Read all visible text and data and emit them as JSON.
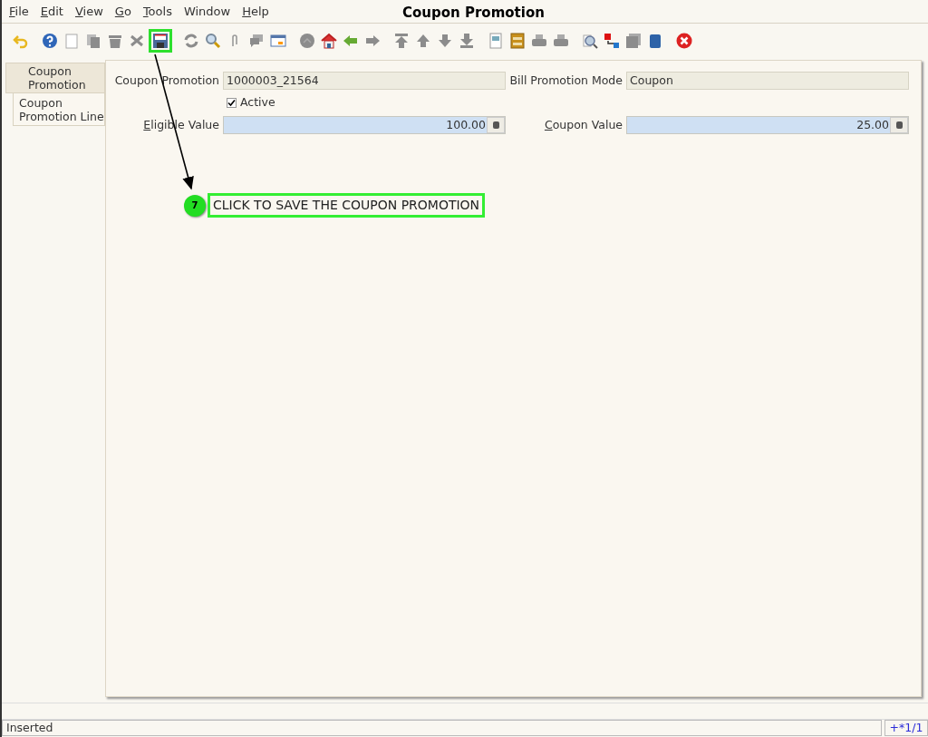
{
  "window": {
    "title": "Coupon Promotion"
  },
  "menu": [
    {
      "label": "File",
      "underlined": true
    },
    {
      "label": "Edit",
      "underlined": true
    },
    {
      "label": "View",
      "underlined": true
    },
    {
      "label": "Go",
      "underlined": true
    },
    {
      "label": "Tools",
      "underlined": true
    },
    {
      "label": "Window",
      "underlined": false
    },
    {
      "label": "Help",
      "underlined": true
    }
  ],
  "toolbar": [
    {
      "kind": "undo",
      "highlighted": false
    },
    {
      "kind": "help",
      "highlighted": false
    },
    {
      "kind": "new",
      "highlighted": false
    },
    {
      "kind": "copy",
      "highlighted": false
    },
    {
      "kind": "delete",
      "highlighted": false
    },
    {
      "kind": "delete-selection",
      "highlighted": false
    },
    {
      "kind": "save",
      "highlighted": true
    },
    {
      "kind": "refresh",
      "highlighted": false
    },
    {
      "kind": "find",
      "highlighted": false
    },
    {
      "kind": "attachment",
      "highlighted": false
    },
    {
      "kind": "chat",
      "highlighted": false
    },
    {
      "kind": "grid",
      "highlighted": false
    },
    {
      "kind": "history",
      "highlighted": false
    },
    {
      "kind": "home",
      "highlighted": false
    },
    {
      "kind": "back",
      "highlighted": false
    },
    {
      "kind": "forward",
      "highlighted": false
    },
    {
      "kind": "first",
      "highlighted": false
    },
    {
      "kind": "previous",
      "highlighted": false
    },
    {
      "kind": "next",
      "highlighted": false
    },
    {
      "kind": "last",
      "highlighted": false
    },
    {
      "kind": "report",
      "highlighted": false
    },
    {
      "kind": "archive",
      "highlighted": false
    },
    {
      "kind": "print-preview",
      "highlighted": false
    },
    {
      "kind": "print",
      "highlighted": false
    },
    {
      "kind": "zoom-across",
      "highlighted": false
    },
    {
      "kind": "workflow",
      "highlighted": false
    },
    {
      "kind": "request",
      "highlighted": false
    },
    {
      "kind": "product",
      "highlighted": false
    },
    {
      "kind": "close",
      "highlighted": false
    }
  ],
  "tabs": [
    {
      "label": "Coupon Promotion",
      "selected": true
    },
    {
      "label": "Coupon Promotion Line",
      "selected": false
    }
  ],
  "form": {
    "coupon_promotion": {
      "label": "Coupon Promotion",
      "value": "1000003_21564",
      "underlined": false
    },
    "bill_promotion_mode": {
      "label": "Bill Promotion Mode",
      "value": "Coupon",
      "underlined": false
    },
    "active": {
      "label": "Active",
      "checked": true
    },
    "eligible_value": {
      "label": "Eligible Value",
      "value": "100.00",
      "underlined": true
    },
    "coupon_value": {
      "label": "Coupon Value",
      "value": "25.00",
      "underlined": true
    }
  },
  "annotation": {
    "step": "7",
    "text": "CLICK TO SAVE THE COUPON PROMOTION"
  },
  "status_bar": {
    "message": "Inserted",
    "record": "+*1/1"
  }
}
